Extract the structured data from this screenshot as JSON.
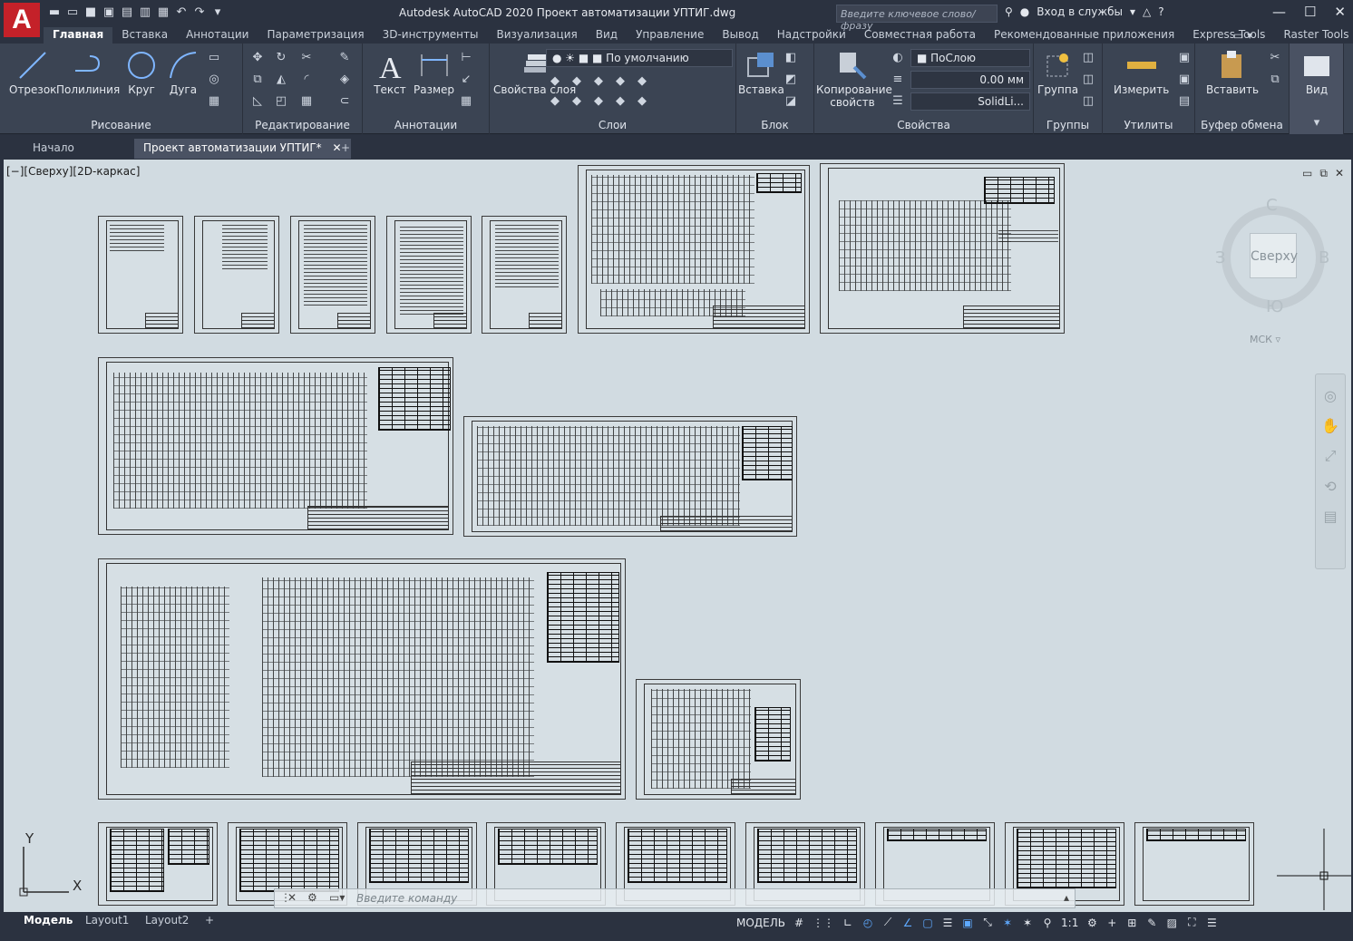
{
  "app": {
    "title": "Autodesk AutoCAD 2020   Проект автоматизации УПТИГ.dwg",
    "logo_letter": "A",
    "search_placeholder": "Введите ключевое слово/фразу",
    "signin_label": "Вход в службы"
  },
  "ribbon_tabs": [
    "Главная",
    "Вставка",
    "Аннотации",
    "Параметризация",
    "3D-инструменты",
    "Визуализация",
    "Вид",
    "Управление",
    "Вывод",
    "Надстройки",
    "Совместная работа",
    "Рекомендованные приложения",
    "Express Tools",
    "Raster Tools"
  ],
  "draw_panel": {
    "title": "Рисование",
    "tools": [
      "Отрезок",
      "Полилиния",
      "Круг",
      "Дуга"
    ]
  },
  "modify_panel": {
    "title": "Редактирование"
  },
  "annotation_panel": {
    "title": "Аннотации",
    "text": "Текст",
    "dimension": "Размер"
  },
  "layers_panel": {
    "title": "Слои",
    "layer_props": "Свойства слоя",
    "current_layer": "По умолчанию"
  },
  "block_panel": {
    "title": "Блок",
    "insert": "Вставка"
  },
  "properties_panel": {
    "title": "Свойства",
    "match": "Копирование свойств",
    "color": "ПоСлою",
    "lineweight": "0.00 мм",
    "linetype": "SolidLi..."
  },
  "groups_panel": {
    "title": "Группы",
    "group": "Группа"
  },
  "utilities_panel": {
    "title": "Утилиты",
    "measure": "Измерить"
  },
  "clipboard_panel": {
    "title": "Буфер обмена",
    "paste": "Вставить"
  },
  "view_panel": {
    "title": "Вид"
  },
  "doc_tabs": [
    "Начало",
    "Проект автоматизации УПТИГ*"
  ],
  "viewport_label": "[−][Сверху][2D-каркас]",
  "viewcube": {
    "face": "Сверху",
    "north": "С",
    "south": "Ю",
    "east": "В",
    "west": "З",
    "wcs": "МСК"
  },
  "ucs": {
    "x": "X",
    "y": "Y"
  },
  "command_placeholder": "Введите команду",
  "layout_tabs": [
    "Модель",
    "Layout1",
    "Layout2"
  ],
  "status": {
    "mode": "МОДЕЛЬ",
    "scale": "1:1"
  }
}
